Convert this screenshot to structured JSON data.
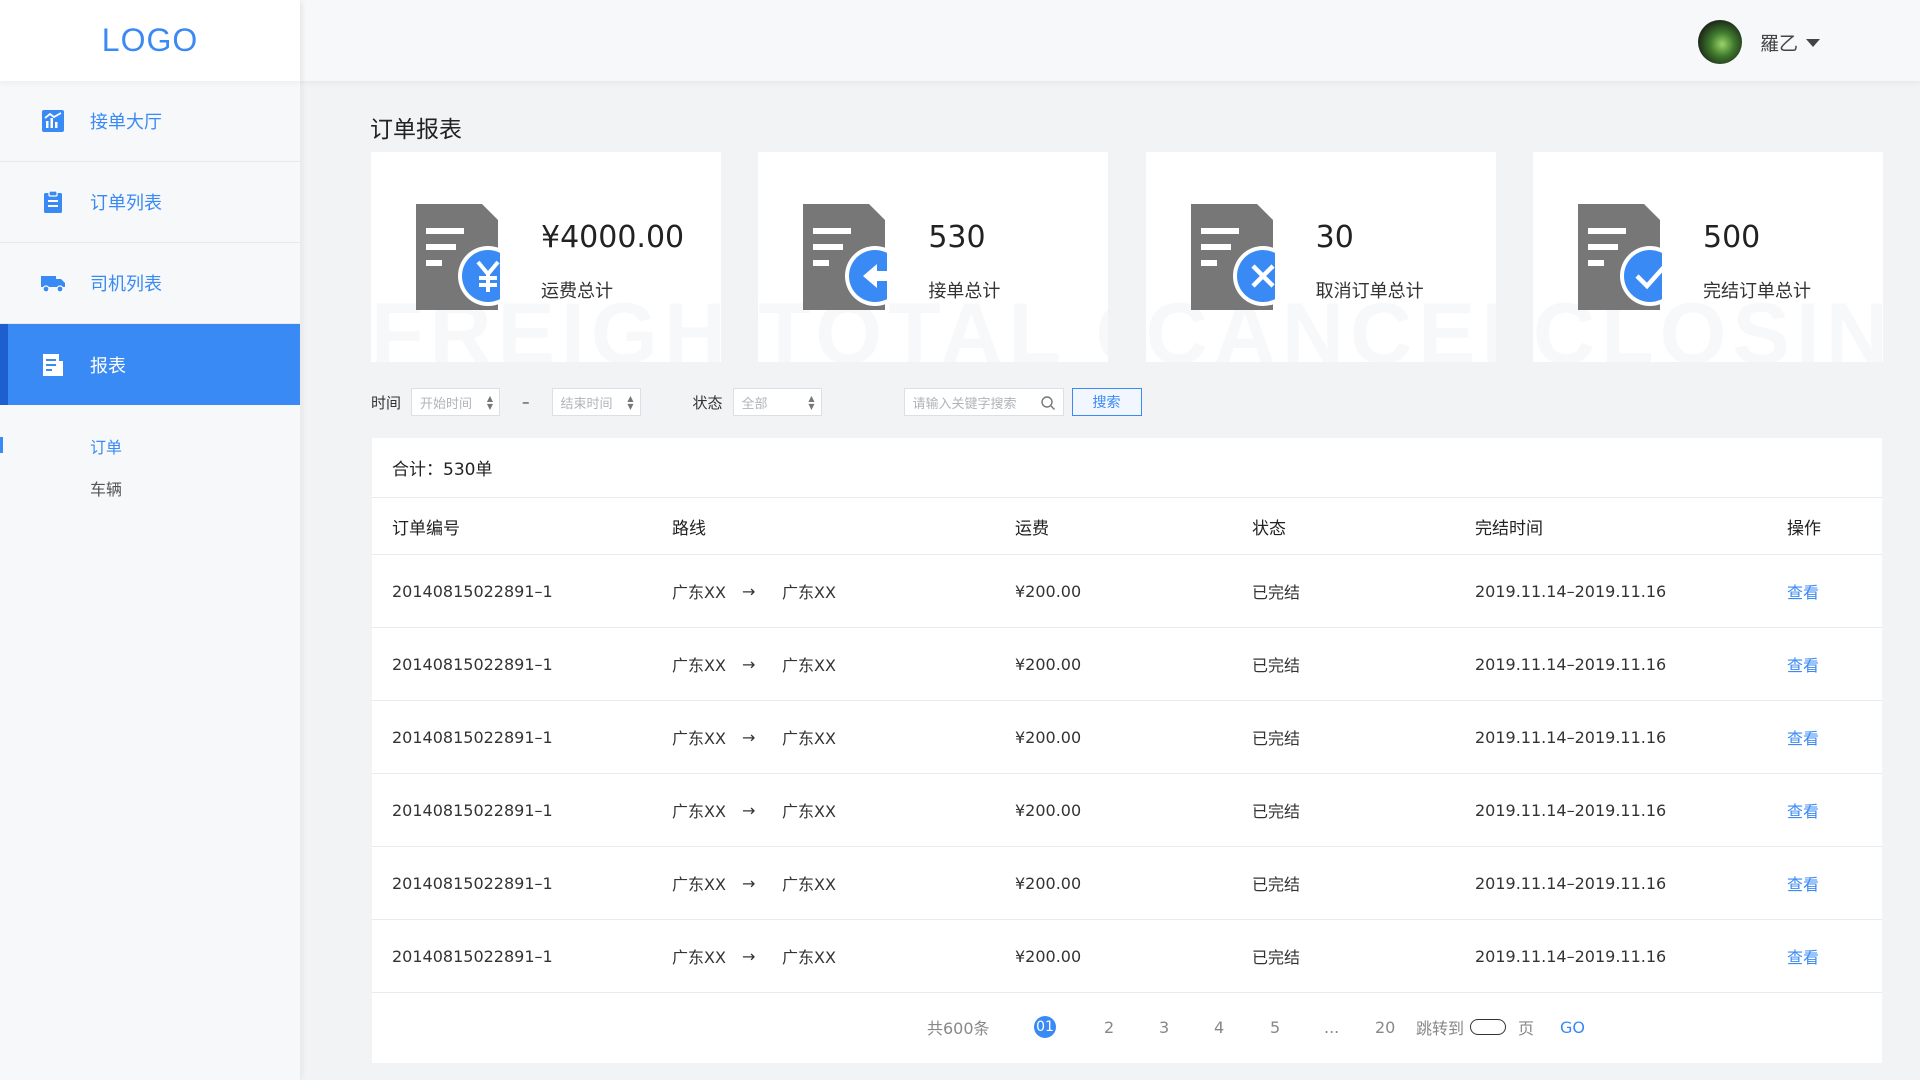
{
  "app": {
    "logo": "LOGO"
  },
  "sidebar": {
    "items": [
      {
        "label": "接单大厅",
        "icon": "chart-icon"
      },
      {
        "label": "订单列表",
        "icon": "clipboard-icon"
      },
      {
        "label": "司机列表",
        "icon": "truck-icon"
      },
      {
        "label": "报表",
        "icon": "report-icon",
        "active": true
      }
    ],
    "sub_items": [
      {
        "label": "订单",
        "active": true
      },
      {
        "label": "车辆"
      }
    ]
  },
  "header": {
    "user_name": "羅乙"
  },
  "page": {
    "title": "订单报表"
  },
  "cards": [
    {
      "value": "¥4000.00",
      "label": "运费总计",
      "watermark": "FREIGHT TOTAL",
      "badge": "yen-icon"
    },
    {
      "value": "530",
      "label": "接单总计",
      "watermark": "TOTAL ORDER",
      "badge": "arrow-left-icon"
    },
    {
      "value": "30",
      "label": "取消订单总计",
      "watermark": "CANCELLATION",
      "badge": "close-icon"
    },
    {
      "value": "500",
      "label": "完结订单总计",
      "watermark": "CLOSING TOTAL",
      "badge": "check-icon"
    }
  ],
  "filters": {
    "time_label": "时间",
    "start_placeholder": "开始时间",
    "dash": "–",
    "end_placeholder": "结束时间",
    "status_label": "状态",
    "status_value": "全部",
    "search_placeholder": "请输入关键字搜索",
    "search_button": "搜索"
  },
  "table": {
    "summary": "合计：530单",
    "columns": [
      "订单编号",
      "路线",
      "运费",
      "状态",
      "完结时间",
      "操作"
    ],
    "rows": [
      {
        "id": "20140815022891–1",
        "from": "广东XX",
        "arrow": "→",
        "to": "广东XX",
        "fee": "¥200.00",
        "status": "已完结",
        "time": "2019.11.14–2019.11.16",
        "action": "查看"
      },
      {
        "id": "20140815022891–1",
        "from": "广东XX",
        "arrow": "→",
        "to": "广东XX",
        "fee": "¥200.00",
        "status": "已完结",
        "time": "2019.11.14–2019.11.16",
        "action": "查看"
      },
      {
        "id": "20140815022891–1",
        "from": "广东XX",
        "arrow": "→",
        "to": "广东XX",
        "fee": "¥200.00",
        "status": "已完结",
        "time": "2019.11.14–2019.11.16",
        "action": "查看"
      },
      {
        "id": "20140815022891–1",
        "from": "广东XX",
        "arrow": "→",
        "to": "广东XX",
        "fee": "¥200.00",
        "status": "已完结",
        "time": "2019.11.14–2019.11.16",
        "action": "查看"
      },
      {
        "id": "20140815022891–1",
        "from": "广东XX",
        "arrow": "→",
        "to": "广东XX",
        "fee": "¥200.00",
        "status": "已完结",
        "time": "2019.11.14–2019.11.16",
        "action": "查看"
      },
      {
        "id": "20140815022891–1",
        "from": "广东XX",
        "arrow": "→",
        "to": "广东XX",
        "fee": "¥200.00",
        "status": "已完结",
        "time": "2019.11.14–2019.11.16",
        "action": "查看"
      }
    ]
  },
  "pagination": {
    "total": "共600条",
    "current": "01",
    "pages": [
      "2",
      "3",
      "4",
      "5"
    ],
    "ellipsis": "...",
    "last": "20",
    "jump_label": "跳转到",
    "page_unit": "页",
    "go": "GO"
  },
  "colors": {
    "accent": "#3a8af5",
    "sidebar_active_border": "#1e5fcf",
    "icon_grey": "#777777"
  }
}
